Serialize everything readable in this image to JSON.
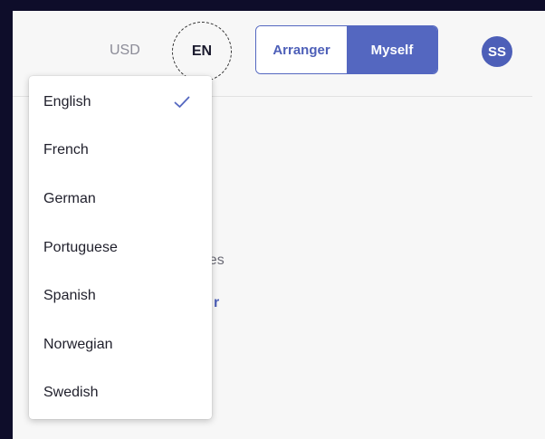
{
  "header": {
    "currency": "USD",
    "language_code": "EN",
    "roles": {
      "arranger": "Arranger",
      "myself": "Myself",
      "selected": "Myself"
    },
    "avatar_initials": "SS"
  },
  "background": {
    "text_fragment": "ages",
    "link_fragment": "r"
  },
  "language_menu": {
    "selected": "English",
    "items": [
      {
        "label": "English",
        "selected": true,
        "icon": "check-icon"
      },
      {
        "label": "French"
      },
      {
        "label": "German"
      },
      {
        "label": "Portuguese"
      },
      {
        "label": "Spanish"
      },
      {
        "label": "Norwegian"
      },
      {
        "label": "Swedish"
      }
    ]
  },
  "colors": {
    "accent": "#5467c0",
    "page_bg": "#f7f7f7",
    "outer_bg": "#0e0d2a"
  }
}
